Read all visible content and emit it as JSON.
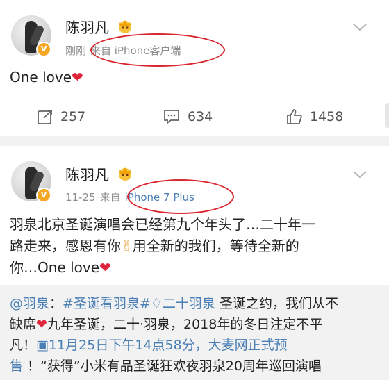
{
  "post1": {
    "username": "陈羽凡",
    "time": "刚刚",
    "source": "来自 iPhone客户端",
    "text": "One love",
    "actions": {
      "repost_count": "257",
      "comment_count": "634",
      "like_count": "1458"
    }
  },
  "post2": {
    "username": "陈羽凡",
    "time": "11-25",
    "source_prefix": "来自",
    "source": "iPhone 7 Plus",
    "text_line1": "羽泉北京圣诞演唱会已经第九个年头了…二十年一",
    "text_line2_a": "路走来，感恩有你",
    "text_line2_b": "用全新的我们，等待全新的",
    "text_line3": "你…One love",
    "repost": {
      "mention": "@羽泉",
      "colon": "：",
      "topic1": "#圣诞看羽泉#",
      "topic2": "二十羽泉",
      "line1_rest": " 圣诞之约，我们从不",
      "line2_a": "缺席",
      "line2_b": "九年圣诞，二十·羽泉，2018年的冬日注定不平",
      "line3_a": "凡！",
      "line3_link": "11月25日下午14点58分，大麦网正式预",
      "line4_link": "售",
      "line4_rest": " ！“获得”小米有品圣诞狂欢夜羽泉20周年巡回演唱"
    }
  },
  "colors": {
    "highlight_circle": "#d9262e",
    "link": "#4a7fb5",
    "heart": "#e0243a",
    "badge": "#f5a623"
  },
  "icons": [
    "avatar",
    "verified-badge-icon",
    "crown-emoji-icon",
    "chevron-down-icon",
    "repost-icon",
    "comment-icon",
    "like-icon",
    "heart-emoji-icon",
    "hand-emoji-icon",
    "calendar-icon",
    "diamond-icon"
  ]
}
